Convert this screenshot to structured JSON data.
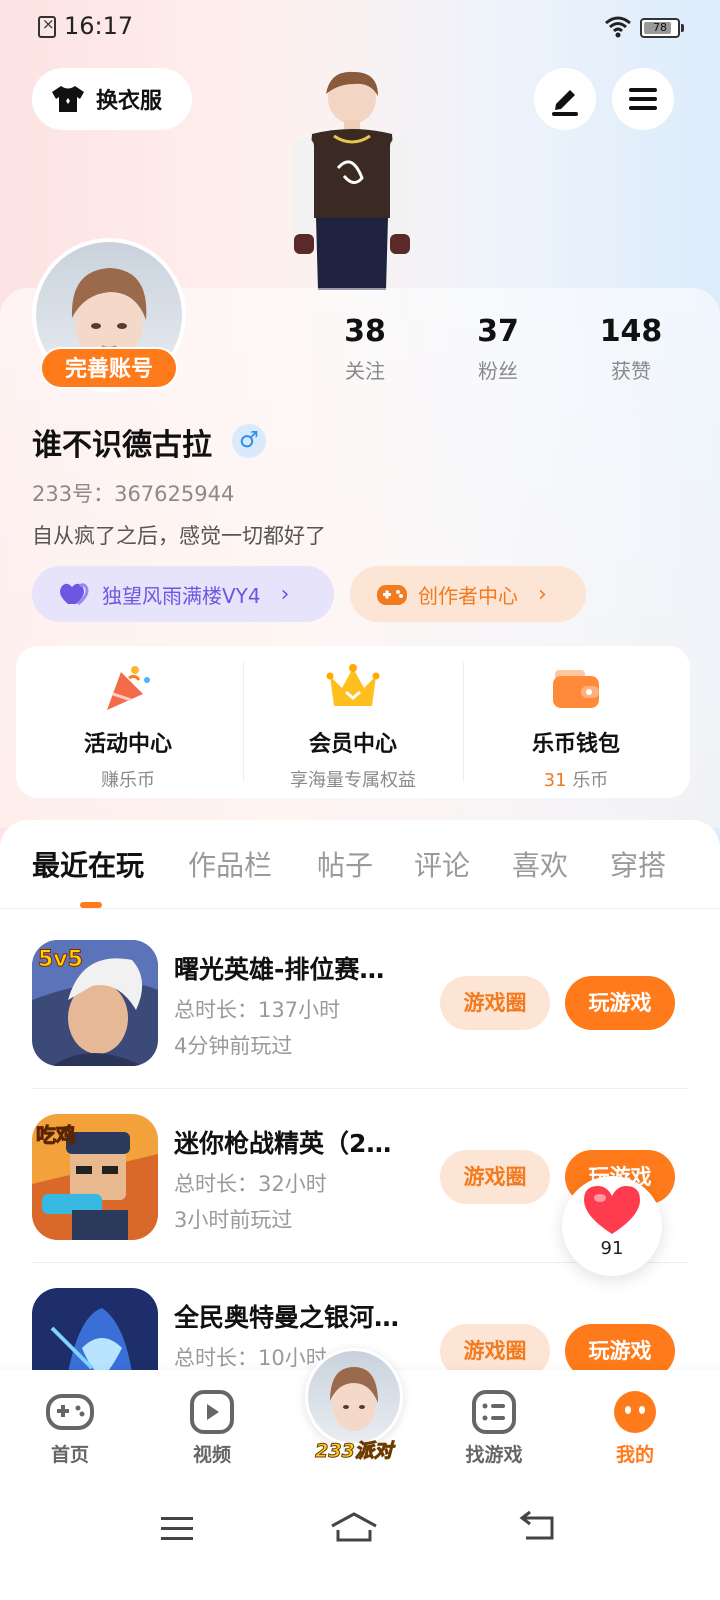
{
  "status_bar": {
    "time": "16:17",
    "battery": "78"
  },
  "top_bar": {
    "dress_label": "换衣服"
  },
  "profile": {
    "complete_label": "完善账号",
    "stats": [
      {
        "value": "38",
        "label": "关注"
      },
      {
        "value": "37",
        "label": "粉丝"
      },
      {
        "value": "148",
        "label": "获赞"
      }
    ],
    "nickname": "谁不识德古拉",
    "gender": "♂",
    "uid": "233号：367625944",
    "bio": "自从疯了之后，感觉一切都好了",
    "vip_label": "独望风雨满楼VY4",
    "creator_label": "创作者中心",
    "chevron": "›"
  },
  "quick": [
    {
      "title": "活动中心",
      "sub": "赚乐币"
    },
    {
      "title": "会员中心",
      "sub": "享海量专属权益"
    },
    {
      "title": "乐币钱包",
      "sub_num": "31",
      "sub_unit": "乐币"
    }
  ],
  "tabs": [
    "最近在玩",
    "作品栏",
    "帖子",
    "评论",
    "喜欢",
    "穿搭"
  ],
  "games": [
    {
      "title": "曙光英雄-排位赛…",
      "duration": "总时长：137小时",
      "last": "4分钟前玩过",
      "icon_badge": "5v5"
    },
    {
      "title": "迷你枪战精英（2…",
      "duration": "总时长：32小时",
      "last": "3小时前玩过",
      "icon_badge": "吃鸡"
    },
    {
      "title": "全民奥特曼之银河…",
      "duration": "总时长：10小时",
      "last": "",
      "icon_badge": ""
    }
  ],
  "game_buttons": {
    "circle": "游戏圈",
    "play": "玩游戏"
  },
  "like_float": {
    "count": "91"
  },
  "bottom_nav": [
    {
      "label": "首页"
    },
    {
      "label": "视频"
    },
    {
      "label": "233派对"
    },
    {
      "label": "找游戏"
    },
    {
      "label": "我的"
    }
  ],
  "colors": {
    "accent": "#ff7a1a",
    "vip": "#6f56e0",
    "gender": "#2f8fe8"
  }
}
